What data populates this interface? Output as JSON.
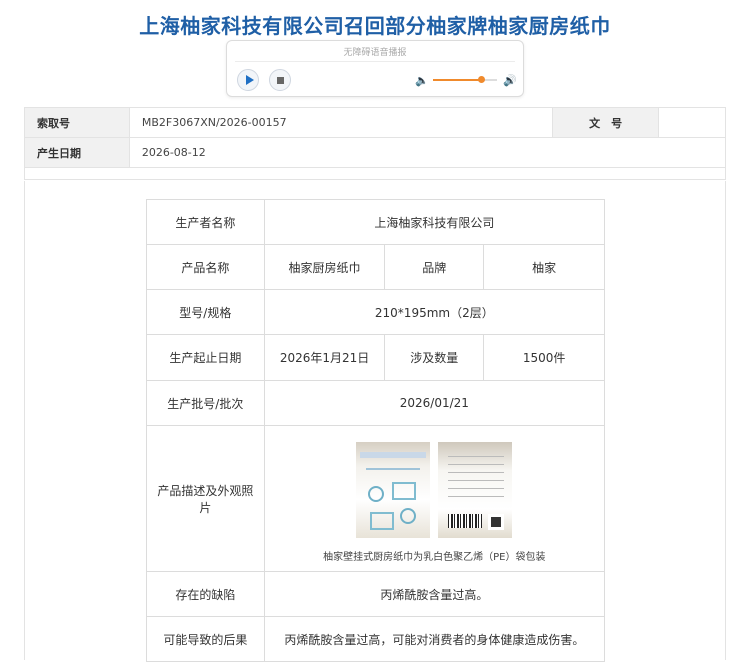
{
  "page_title": "上海柚家科技有限公司召回部分柚家牌柚家厨房纸巾",
  "player": {
    "label": "无障碍语音播报",
    "volume_level": 0.75,
    "accent_color": "#f08a2c"
  },
  "meta": {
    "index_no_label": "索取号",
    "index_no_value": "MB2F3067XN/2026-00157",
    "doc_no_label": "文　号",
    "doc_no_value": "",
    "date_label": "产生日期",
    "date_value": "2026-08-12"
  },
  "detail": {
    "producer_label": "生产者名称",
    "producer_value": "上海柚家科技有限公司",
    "product_label": "产品名称",
    "product_value": "柚家厨房纸巾",
    "brand_label": "品牌",
    "brand_value": "柚家",
    "model_label": "型号/规格",
    "model_value": "210*195mm（2层）",
    "period_label": "生产起止日期",
    "period_value": "2026年1月21日",
    "qty_label": "涉及数量",
    "qty_value": "1500件",
    "batch_label": "生产批号/批次",
    "batch_value": "2026/01/21",
    "photo_label": "产品描述及外观照片",
    "photo_caption": "柚家壁挂式厨房纸巾为乳白色聚乙烯（PE）袋包装",
    "defect_label": "存在的缺陷",
    "defect_value": "丙烯酰胺含量过高。",
    "consequence_label": "可能导致的后果",
    "consequence_value": "丙烯酰胺含量过高，可能对消费者的身体健康造成伤害。"
  },
  "icons": {
    "play": "play-icon",
    "stop": "stop-icon",
    "volume_low": "volume-low-icon",
    "volume_high": "volume-high-icon"
  },
  "colors": {
    "title": "#1f5fa6",
    "label_bg": "#f1f1f1"
  }
}
